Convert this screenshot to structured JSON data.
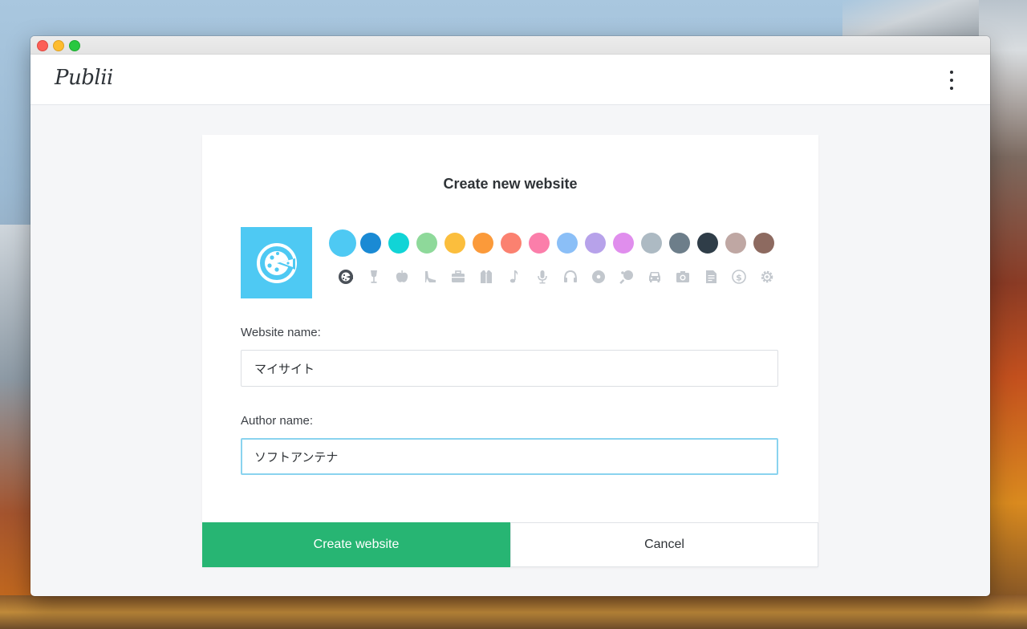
{
  "app": {
    "logo": "Publii"
  },
  "dialog": {
    "title": "Create new website",
    "selected_color": "#4ec9f3",
    "colors": [
      "#4ec9f3",
      "#1a8ad4",
      "#11d4d6",
      "#8ed99a",
      "#fbbe3d",
      "#fb9a3a",
      "#fb8170",
      "#fb7eaa",
      "#8bbff7",
      "#b7a2ea",
      "#e08eed",
      "#adbac3",
      "#6d7e8a",
      "#2f3d48",
      "#bfa7a3",
      "#8d6a60"
    ],
    "icons": [
      "pizza-icon",
      "wine-glass-icon",
      "apple-icon",
      "high-heel-icon",
      "briefcase-icon",
      "shirt-icon",
      "music-note-icon",
      "microphone-icon",
      "headphones-icon",
      "disc-icon",
      "ping-pong-icon",
      "car-icon",
      "camera-icon",
      "document-icon",
      "dollar-icon",
      "gear-icon"
    ],
    "website_name_label": "Website name:",
    "website_name_value": "マイサイト",
    "author_name_label": "Author name:",
    "author_name_value": "ソフトアンテナ",
    "create_button": "Create website",
    "cancel_button": "Cancel"
  }
}
